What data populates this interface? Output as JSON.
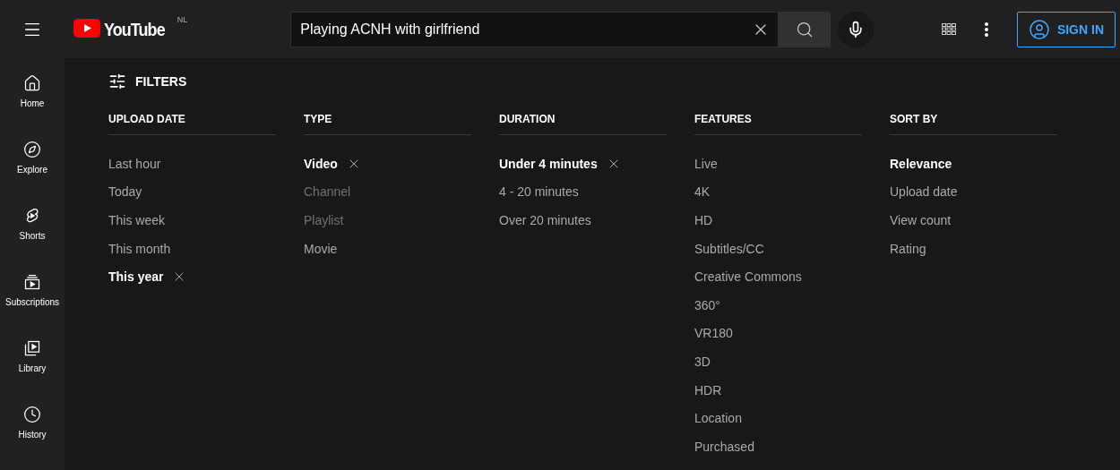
{
  "header": {
    "logo": "YouTube",
    "country": "NL",
    "search": {
      "value": "Playing ACNH with girlfriend"
    },
    "sign_in": "SIGN IN"
  },
  "sidebar": {
    "items": [
      {
        "label": "Home"
      },
      {
        "label": "Explore"
      },
      {
        "label": "Shorts"
      },
      {
        "label": "Subscriptions"
      },
      {
        "label": "Library"
      },
      {
        "label": "History"
      }
    ]
  },
  "filters": {
    "title": "FILTERS",
    "groups": [
      {
        "heading": "UPLOAD DATE",
        "options": [
          {
            "label": "Last hour",
            "selected": false,
            "disabled": false
          },
          {
            "label": "Today",
            "selected": false,
            "disabled": false
          },
          {
            "label": "This week",
            "selected": false,
            "disabled": false
          },
          {
            "label": "This month",
            "selected": false,
            "disabled": false
          },
          {
            "label": "This year",
            "selected": true,
            "disabled": false
          }
        ]
      },
      {
        "heading": "TYPE",
        "options": [
          {
            "label": "Video",
            "selected": true,
            "disabled": false
          },
          {
            "label": "Channel",
            "selected": false,
            "disabled": true
          },
          {
            "label": "Playlist",
            "selected": false,
            "disabled": true
          },
          {
            "label": "Movie",
            "selected": false,
            "disabled": false
          }
        ]
      },
      {
        "heading": "DURATION",
        "options": [
          {
            "label": "Under 4 minutes",
            "selected": true,
            "disabled": false
          },
          {
            "label": "4 - 20 minutes",
            "selected": false,
            "disabled": false
          },
          {
            "label": "Over 20 minutes",
            "selected": false,
            "disabled": false
          }
        ]
      },
      {
        "heading": "FEATURES",
        "options": [
          {
            "label": "Live",
            "selected": false,
            "disabled": false
          },
          {
            "label": "4K",
            "selected": false,
            "disabled": false
          },
          {
            "label": "HD",
            "selected": false,
            "disabled": false
          },
          {
            "label": "Subtitles/CC",
            "selected": false,
            "disabled": false
          },
          {
            "label": "Creative Commons",
            "selected": false,
            "disabled": false
          },
          {
            "label": "360°",
            "selected": false,
            "disabled": false
          },
          {
            "label": "VR180",
            "selected": false,
            "disabled": false
          },
          {
            "label": "3D",
            "selected": false,
            "disabled": false
          },
          {
            "label": "HDR",
            "selected": false,
            "disabled": false
          },
          {
            "label": "Location",
            "selected": false,
            "disabled": false
          },
          {
            "label": "Purchased",
            "selected": false,
            "disabled": false
          }
        ]
      },
      {
        "heading": "SORT BY",
        "options": [
          {
            "label": "Relevance",
            "selected": true,
            "disabled": false
          },
          {
            "label": "Upload date",
            "selected": false,
            "disabled": false
          },
          {
            "label": "View count",
            "selected": false,
            "disabled": false
          },
          {
            "label": "Rating",
            "selected": false,
            "disabled": false
          }
        ]
      }
    ]
  }
}
